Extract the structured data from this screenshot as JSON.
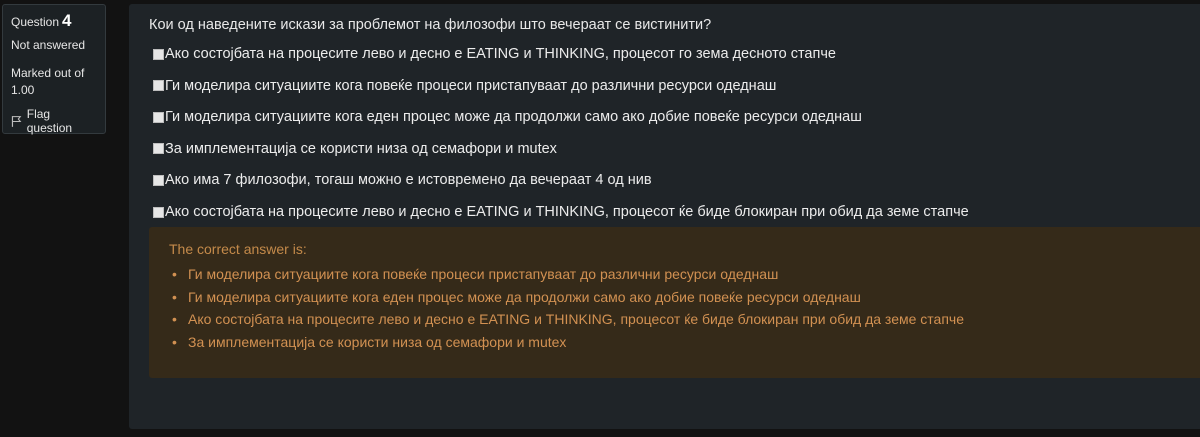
{
  "info": {
    "question_label": "Question",
    "question_number": "4",
    "state": "Not answered",
    "grade_line1": "Marked out of",
    "grade_line2": "1.00",
    "flag_label": "Flag question"
  },
  "question": {
    "text": "Кои од наведените искази за проблемот на филозофи што вечераат се вистинити?",
    "options": [
      {
        "label": "Ако состојбата на процесите лево и десно е EATING и THINKING, процесот го зема десното стапче",
        "checked": false
      },
      {
        "label": "Ги моделира ситуациите кога повеќе процеси пристапуваат до различни ресурси одеднаш",
        "checked": false
      },
      {
        "label": "Ги моделира ситуациите кога еден процес може да продолжи само ако добие повеќе ресурси одеднаш",
        "checked": false
      },
      {
        "label": "За имплементација се користи низа од семафори и mutex",
        "checked": false
      },
      {
        "label": "Ако има 7 филозофи, тогаш можно е истовремено да вечераат 4 од нив",
        "checked": false
      },
      {
        "label": "Ако состојбата на процесите лево и десно е EATING и THINKING, процесот ќе биде блокиран при обид да земе стапче",
        "checked": false
      }
    ]
  },
  "feedback": {
    "title": "The correct answer is:",
    "answers": [
      "Ги моделира ситуациите кога повеќе процеси пристапуваат до различни ресурси одеднаш",
      "Ги моделира ситуациите кога еден процес може да продолжи само ако добие повеќе ресурси одеднаш",
      "Ако состојбата на процесите лево и десно е EATING и THINKING, процесот ќе биде блокиран при обид да земе стапче",
      "За имплементација се користи низа од семафори и mutex"
    ],
    "bullet": "•"
  },
  "colors": {
    "page_background": "#121212",
    "panel_background": "#1f2428",
    "feedback_background": "#352a19",
    "feedback_text": "#d29152"
  }
}
